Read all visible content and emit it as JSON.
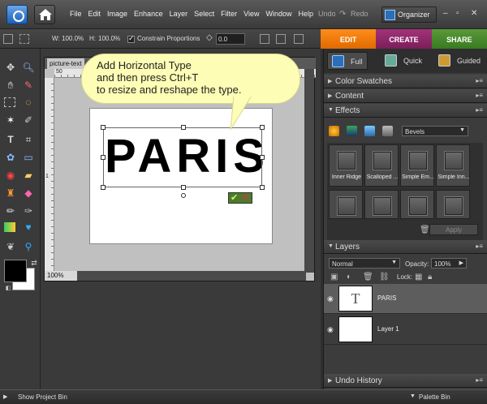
{
  "menubar": {
    "items": [
      "File",
      "Edit",
      "Image",
      "Enhance",
      "Layer",
      "Select",
      "Filter",
      "View",
      "Window",
      "Help"
    ],
    "undo": "Undo",
    "redo": "Redo",
    "organizer": "Organizer"
  },
  "options": {
    "w_label": "W:",
    "w_value": "100.0%",
    "h_label": "H:",
    "h_value": "100.0%",
    "constrain": "Constrain Proportions",
    "angle": "0.0"
  },
  "modes": [
    "EDIT",
    "CREATE",
    "SHARE"
  ],
  "document": {
    "tab": "picture-text",
    "zoom": "100%",
    "text": "PARIS",
    "ruler_marks": [
      "50",
      "1"
    ]
  },
  "balloon": {
    "lines": [
      "Add Horizontal Type",
      "and then press Ctrl+T",
      "to resize and reshape the type."
    ]
  },
  "panel": {
    "view_tabs": [
      "Full",
      "Quick",
      "Guided"
    ],
    "sections": {
      "swatches": "Color Swatches",
      "content": "Content",
      "effects": "Effects",
      "layers": "Layers",
      "undo_history": "Undo History"
    },
    "effects_dropdown": "Bevels",
    "effects": [
      "Inner Ridge",
      "Scalloped ...",
      "Simple Em...",
      "Simple Inn..."
    ],
    "apply": "Apply",
    "blend_mode": "Normal",
    "opacity_label": "Opacity:",
    "opacity_value": "100%",
    "lock_label": "Lock:",
    "layers": [
      {
        "name": "PARIS",
        "type_glyph": "T"
      },
      {
        "name": "Layer 1"
      }
    ]
  },
  "bottom": {
    "left": "Show Project Bin",
    "right": "Palette Bin"
  },
  "colors": {
    "edit": "#ff8d1a",
    "create": "#a3327a",
    "share": "#5a9a3a",
    "balloon": "#fdfdb5"
  }
}
